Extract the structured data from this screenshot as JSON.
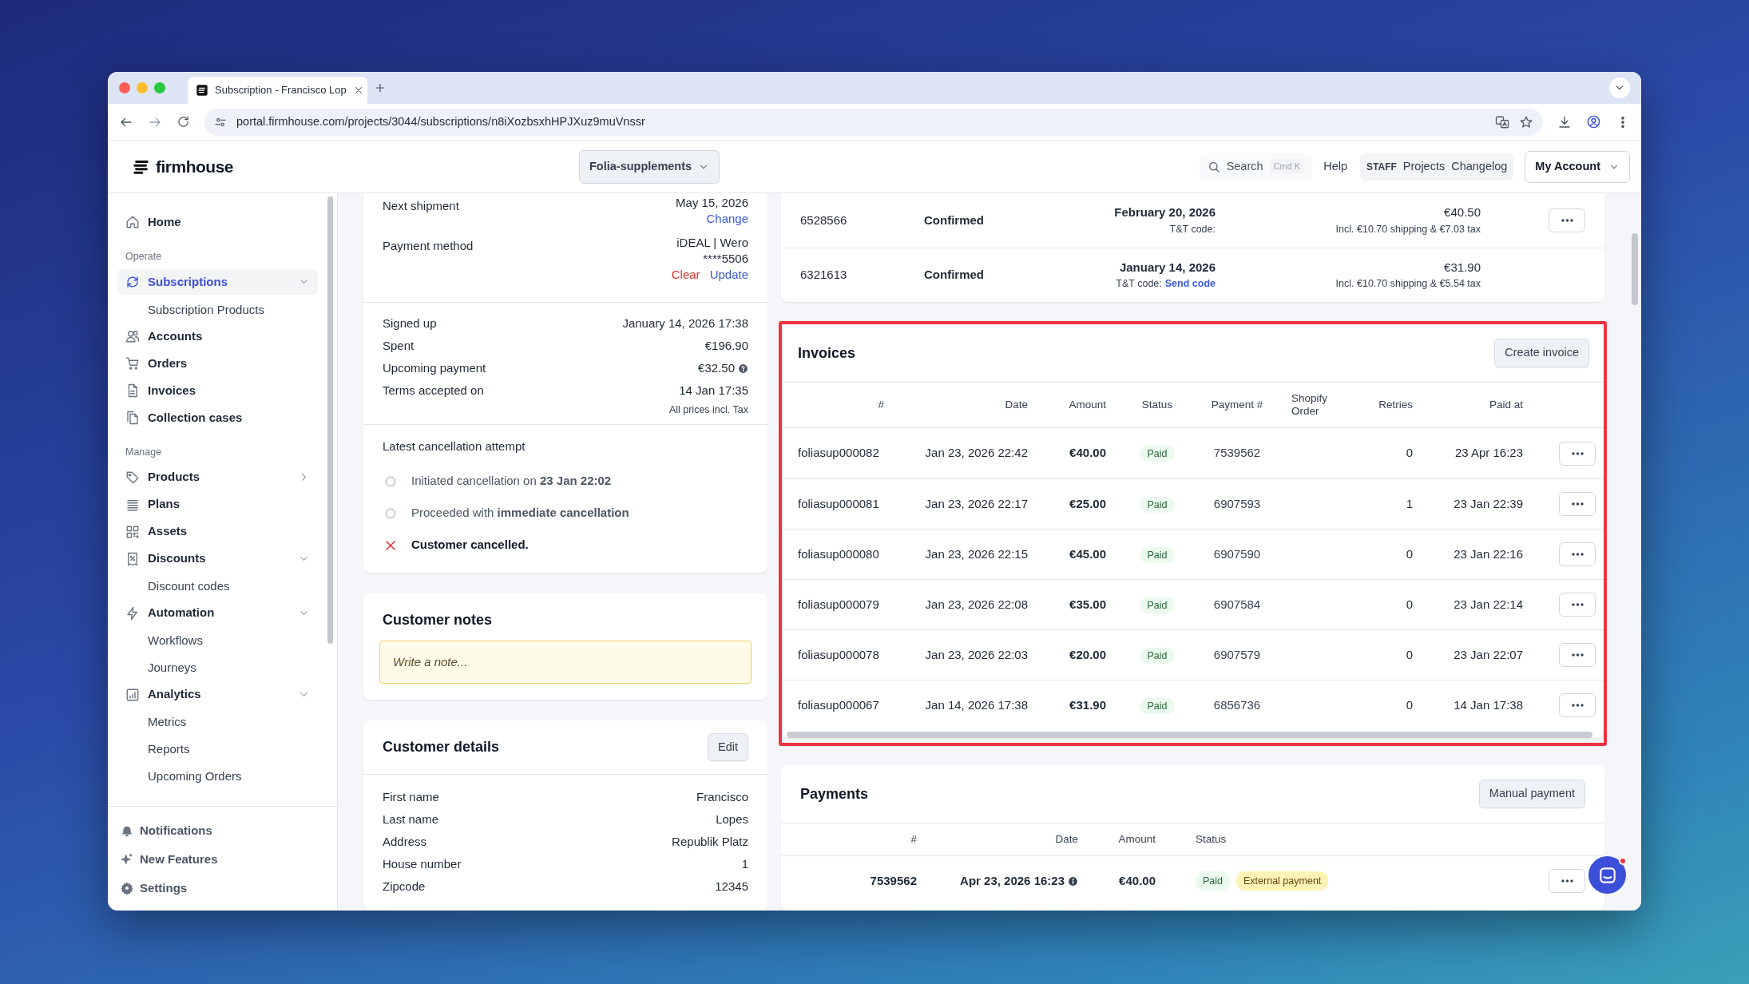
{
  "browser": {
    "tab_title": "Subscription - Francisco Lop",
    "url": "portal.firmhouse.com/projects/3044/subscriptions/n8iXozbsxhHPJXuz9muVnssr"
  },
  "header": {
    "logo": "firmhouse",
    "project": "Folia-supplements",
    "search": {
      "placeholder": "Search",
      "shortcut": "Cmd K"
    },
    "help": "Help",
    "staff_badge": "STAFF",
    "staff_links": [
      "Projects",
      "Changelog"
    ],
    "account": "My Account"
  },
  "sidebar": {
    "items": [
      {
        "kind": "item",
        "label": "Home",
        "selected": false
      },
      {
        "kind": "section",
        "label": "Operate"
      },
      {
        "kind": "item",
        "label": "Subscriptions",
        "selected": true,
        "expanded": true
      },
      {
        "kind": "subitem",
        "label": "Subscription Products"
      },
      {
        "kind": "item",
        "label": "Accounts",
        "selected": false
      },
      {
        "kind": "item",
        "label": "Orders",
        "selected": false
      },
      {
        "kind": "item",
        "label": "Invoices",
        "selected": false
      },
      {
        "kind": "item",
        "label": "Collection cases",
        "selected": false
      },
      {
        "kind": "section",
        "label": "Manage"
      },
      {
        "kind": "item",
        "label": "Products",
        "selected": false,
        "expanded": false
      },
      {
        "kind": "item",
        "label": "Plans",
        "selected": false
      },
      {
        "kind": "item",
        "label": "Assets",
        "selected": false
      },
      {
        "kind": "item",
        "label": "Discounts",
        "selected": false,
        "expanded": true
      },
      {
        "kind": "subitem",
        "label": "Discount codes"
      },
      {
        "kind": "item",
        "label": "Automation",
        "selected": false,
        "expanded": true
      },
      {
        "kind": "subitem",
        "label": "Workflows"
      },
      {
        "kind": "subitem",
        "label": "Journeys"
      },
      {
        "kind": "item",
        "label": "Analytics",
        "selected": false,
        "expanded": true
      },
      {
        "kind": "subitem",
        "label": "Metrics"
      },
      {
        "kind": "subitem",
        "label": "Reports"
      },
      {
        "kind": "subitem",
        "label": "Upcoming Orders"
      }
    ],
    "footer": [
      "Notifications",
      "New Features",
      "Settings"
    ]
  },
  "subscription_card": {
    "rows": [
      {
        "label": "Next shipment",
        "values": [
          "May 15, 2026"
        ],
        "links": [
          {
            "text": "Change",
            "kind": "link"
          }
        ]
      },
      {
        "label": "Payment method",
        "values": [
          "iDEAL | Wero",
          "****5506"
        ],
        "links": [
          {
            "text": "Clear",
            "kind": "danger"
          },
          {
            "text": "Update",
            "kind": "link"
          }
        ]
      }
    ],
    "stats": [
      {
        "label": "Signed up",
        "value": "January 14, 2026 17:38",
        "help": false
      },
      {
        "label": "Spent",
        "value": "€196.90",
        "help": false
      },
      {
        "label": "Upcoming payment",
        "value": "€32.50",
        "help": true
      },
      {
        "label": "Terms accepted on",
        "value": "14 Jan 17:35",
        "help": false
      }
    ],
    "note": "All prices incl. Tax",
    "cancellation": {
      "title": "Latest cancellation attempt",
      "steps": [
        {
          "text": "Initiated cancellation on **23 Jan 22:02**",
          "kind": "pending"
        },
        {
          "text": "Proceeded with **immediate cancellation**",
          "kind": "pending"
        },
        {
          "text": "Customer cancelled.",
          "kind": "failed"
        }
      ]
    }
  },
  "customer_notes": {
    "title": "Customer notes",
    "placeholder": "Write a note..."
  },
  "customer_details": {
    "title": "Customer details",
    "button": "Edit",
    "rows": [
      {
        "label": "First name",
        "value": "Francisco"
      },
      {
        "label": "Last name",
        "value": "Lopes"
      },
      {
        "label": "Address",
        "value": "Republik Platz"
      },
      {
        "label": "House number",
        "value": "1"
      },
      {
        "label": "Zipcode",
        "value": "12345"
      }
    ]
  },
  "orders": {
    "rows": [
      {
        "number": "6528566",
        "status": "Confirmed",
        "date": "February 20, 2026",
        "tt_label": "T&T code:",
        "amount": "€40.50",
        "breakdown": "Incl. €10.70 shipping & €7.03 tax",
        "menu": true
      },
      {
        "number": "6321613",
        "status": "Confirmed",
        "date": "January 14, 2026",
        "tt_label": "T&T code:",
        "tt_link": "Send code",
        "amount": "€31.90",
        "breakdown": "Incl. €10.70 shipping & €5.54 tax",
        "menu": false
      }
    ]
  },
  "invoices": {
    "title": "Invoices",
    "button": "Create invoice",
    "highlight": true,
    "columns": [
      "#",
      "Date",
      "Amount",
      "Status",
      "Payment #",
      "Shopify Order",
      "Retries",
      "Paid at"
    ],
    "rows": [
      {
        "number": "foliasup000082",
        "date": "Jan 23, 2026 22:42",
        "amount": "€40.00",
        "status": {
          "text": "Paid",
          "kind": "success"
        },
        "payment": "7539562",
        "retries": "0",
        "paid_at": "23 Apr 16:23"
      },
      {
        "number": "foliasup000081",
        "date": "Jan 23, 2026 22:17",
        "amount": "€25.00",
        "status": {
          "text": "Paid",
          "kind": "success"
        },
        "payment": "6907593",
        "retries": "1",
        "paid_at": "23 Jan 22:39"
      },
      {
        "number": "foliasup000080",
        "date": "Jan 23, 2026 22:15",
        "amount": "€45.00",
        "status": {
          "text": "Paid",
          "kind": "success"
        },
        "payment": "6907590",
        "retries": "0",
        "paid_at": "23 Jan 22:16"
      },
      {
        "number": "foliasup000079",
        "date": "Jan 23, 2026 22:08",
        "amount": "€35.00",
        "status": {
          "text": "Paid",
          "kind": "success"
        },
        "payment": "6907584",
        "retries": "0",
        "paid_at": "23 Jan 22:14"
      },
      {
        "number": "foliasup000078",
        "date": "Jan 23, 2026 22:03",
        "amount": "€20.00",
        "status": {
          "text": "Paid",
          "kind": "success"
        },
        "payment": "6907579",
        "retries": "0",
        "paid_at": "23 Jan 22:07"
      },
      {
        "number": "foliasup000067",
        "date": "Jan 14, 2026 17:38",
        "amount": "€31.90",
        "status": {
          "text": "Paid",
          "kind": "success"
        },
        "payment": "6856736",
        "retries": "0",
        "paid_at": "14 Jan 17:38"
      }
    ]
  },
  "payments": {
    "title": "Payments",
    "button": "Manual payment",
    "columns": [
      "#",
      "Date",
      "Amount",
      "Status"
    ],
    "rows": [
      {
        "number": "7539562",
        "date": "Apr 23, 2026 16:23",
        "info": true,
        "amount": "€40.00",
        "badges": [
          {
            "text": "Paid",
            "kind": "success"
          },
          {
            "text": "External payment",
            "kind": "warning"
          }
        ]
      }
    ]
  }
}
